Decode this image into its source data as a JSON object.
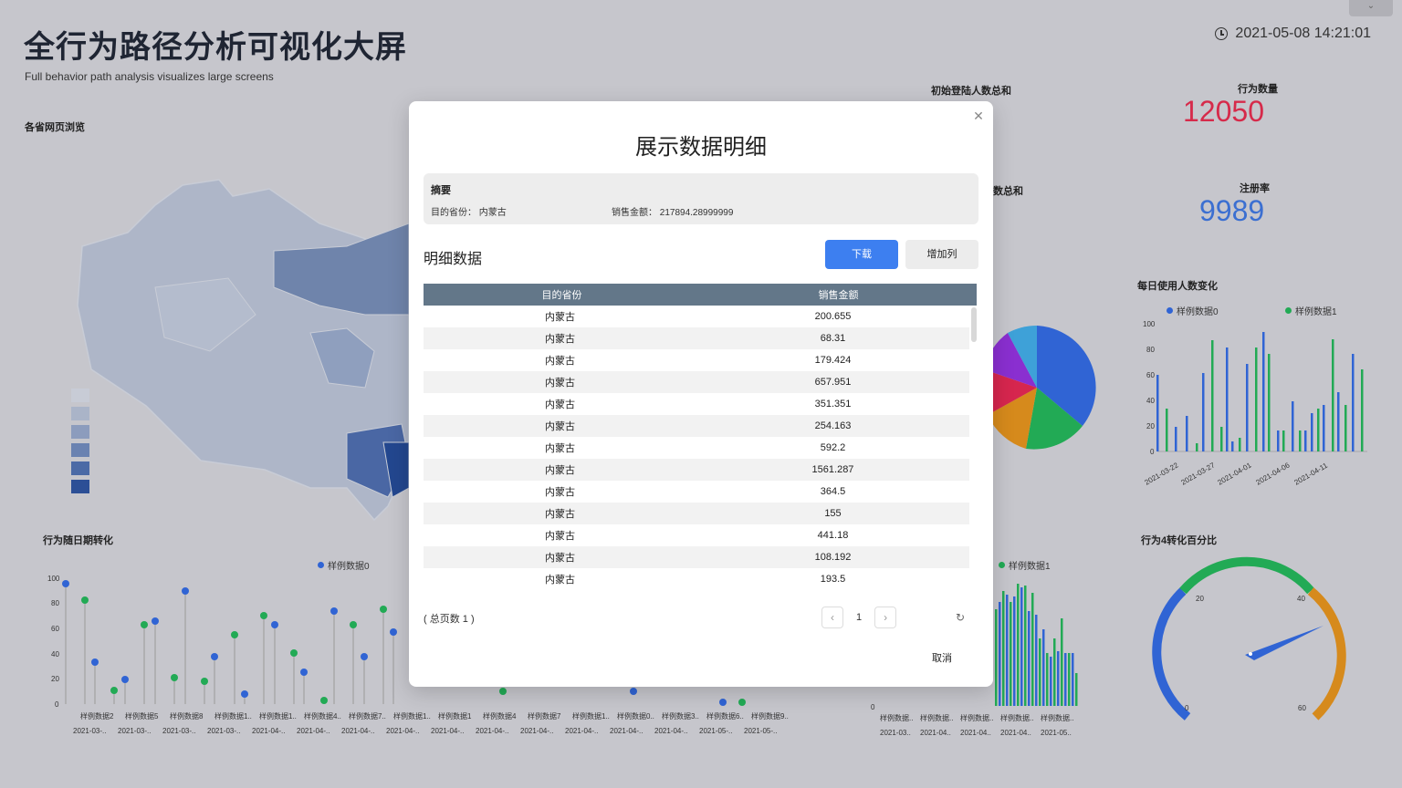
{
  "header": {
    "title": "全行为路径分析可视化大屏",
    "subtitle": "Full behavior path analysis visualizes large screens",
    "datetime": "2021-05-08 14:21:01"
  },
  "map_section": {
    "label": "各省网页浏览"
  },
  "kpis": {
    "login_total_label": "初始登陆人数总和",
    "behavior_count_label": "行为数量",
    "behavior_count_value": "12050",
    "second_total_label_partial": "数总和",
    "register_rate_label": "注册率",
    "register_rate_value": "9989"
  },
  "daily_users": {
    "label": "每日使用人数变化",
    "legend": [
      "样例数据0",
      "样例数据1"
    ],
    "y_ticks": [
      "100",
      "80",
      "60",
      "40",
      "20",
      "0"
    ],
    "x_ticks": [
      "2021-03-22",
      "2021-03-27",
      "2021-04-01",
      "2021-04-06",
      "2021-04-11"
    ]
  },
  "date_trend": {
    "label": "行为随日期转化",
    "legend0": "样例数据0",
    "y_ticks": [
      "100",
      "80",
      "60",
      "40",
      "20",
      "0"
    ],
    "x_names": [
      "样例数据2",
      "样例数据5",
      "样例数据8",
      "样例数据1..",
      "样例数据1..",
      "样例数据4..",
      "样例数据7..",
      "样例数据1..",
      "样例数据1",
      "样例数据4",
      "样例数据7",
      "样例数据1..",
      "样例数据0..",
      "样例数据3..",
      "样例数据6..",
      "样例数据9.."
    ],
    "x_dates": [
      "2021-03-..",
      "2021-03-..",
      "2021-03-..",
      "2021-03-..",
      "2021-04-..",
      "2021-04-..",
      "2021-04-..",
      "2021-04-..",
      "2021-04-..",
      "2021-04-..",
      "2021-04-..",
      "2021-04-..",
      "2021-04-..",
      "2021-04-..",
      "2021-05-..",
      "2021-05-.."
    ]
  },
  "bar_right": {
    "legend1": "样例数据1",
    "x_names": [
      "样例数据..",
      "样例数据..",
      "样例数据..",
      "样例数据..",
      "样例数据.."
    ],
    "x_dates": [
      "2021-03..",
      "2021-04..",
      "2021-04..",
      "2021-04..",
      "2021-05.."
    ],
    "y0": "0"
  },
  "gauge": {
    "label": "行为4转化百分比",
    "ticks": [
      "0",
      "20",
      "40",
      "60"
    ]
  },
  "map_legend_colors": [
    "#c8ccd6",
    "#aab4c8",
    "#8c9cbd",
    "#6a82b1",
    "#4b6aa6",
    "#2c4f96"
  ],
  "modal": {
    "title": "展示数据明细",
    "summary_title": "摘要",
    "summary_province_label": "目的省份：",
    "summary_province_value": "内蒙古",
    "summary_amount_label": "销售金额：",
    "summary_amount_value": "217894.28999999",
    "detail_title": "明细数据",
    "download_label": "下载",
    "add_column_label": "增加列",
    "columns": [
      "目的省份",
      "销售金额"
    ],
    "rows": [
      [
        "内蒙古",
        "200.655"
      ],
      [
        "内蒙古",
        "68.31"
      ],
      [
        "内蒙古",
        "179.424"
      ],
      [
        "内蒙古",
        "657.951"
      ],
      [
        "内蒙古",
        "351.351"
      ],
      [
        "内蒙古",
        "254.163"
      ],
      [
        "内蒙古",
        "592.2"
      ],
      [
        "内蒙古",
        "1561.287"
      ],
      [
        "内蒙古",
        "364.5"
      ],
      [
        "内蒙古",
        "155"
      ],
      [
        "内蒙古",
        "441.18"
      ],
      [
        "内蒙古",
        "108.192"
      ],
      [
        "内蒙古",
        "193.5"
      ]
    ],
    "total_pages": "( 总页数 1 )",
    "current_page": "1",
    "cancel_label": "取消"
  }
}
